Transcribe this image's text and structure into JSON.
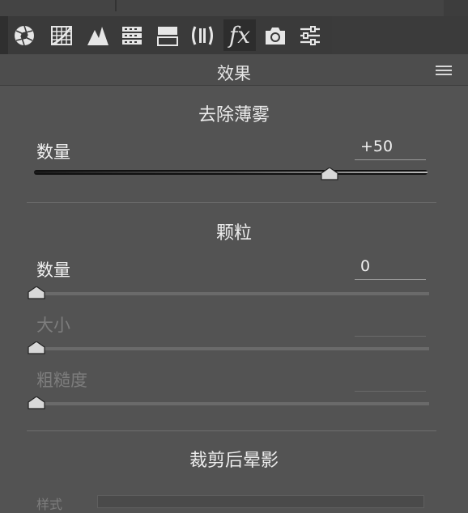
{
  "toolbar": {
    "tabs": [
      {
        "name": "basic-tab",
        "icon": "aperture-icon"
      },
      {
        "name": "tone-curve-tab",
        "icon": "curve-grid-icon"
      },
      {
        "name": "detail-tab",
        "icon": "mountains-icon"
      },
      {
        "name": "hsl-tab",
        "icon": "hsl-bars-icon"
      },
      {
        "name": "split-toning-tab",
        "icon": "split-tone-icon"
      },
      {
        "name": "lens-corrections-tab",
        "icon": "lens-icon"
      },
      {
        "name": "effects-tab",
        "icon": "fx-icon",
        "label": "fx",
        "active": true
      },
      {
        "name": "camera-calibration-tab",
        "icon": "camera-icon"
      },
      {
        "name": "presets-tab",
        "icon": "sliders-icon"
      }
    ]
  },
  "panel": {
    "title": "效果"
  },
  "dehaze": {
    "title": "去除薄雾",
    "amount_label": "数量",
    "amount_value": "+50",
    "position": 0.75
  },
  "grain": {
    "title": "颗粒",
    "amount_label": "数量",
    "amount_value": "0",
    "amount_position": 0.0,
    "size_label": "大小",
    "size_value": "",
    "size_position": 0.0,
    "roughness_label": "粗糙度",
    "roughness_value": "",
    "roughness_position": 0.0
  },
  "vignette": {
    "title": "裁剪后晕影",
    "style_label": "样式"
  }
}
